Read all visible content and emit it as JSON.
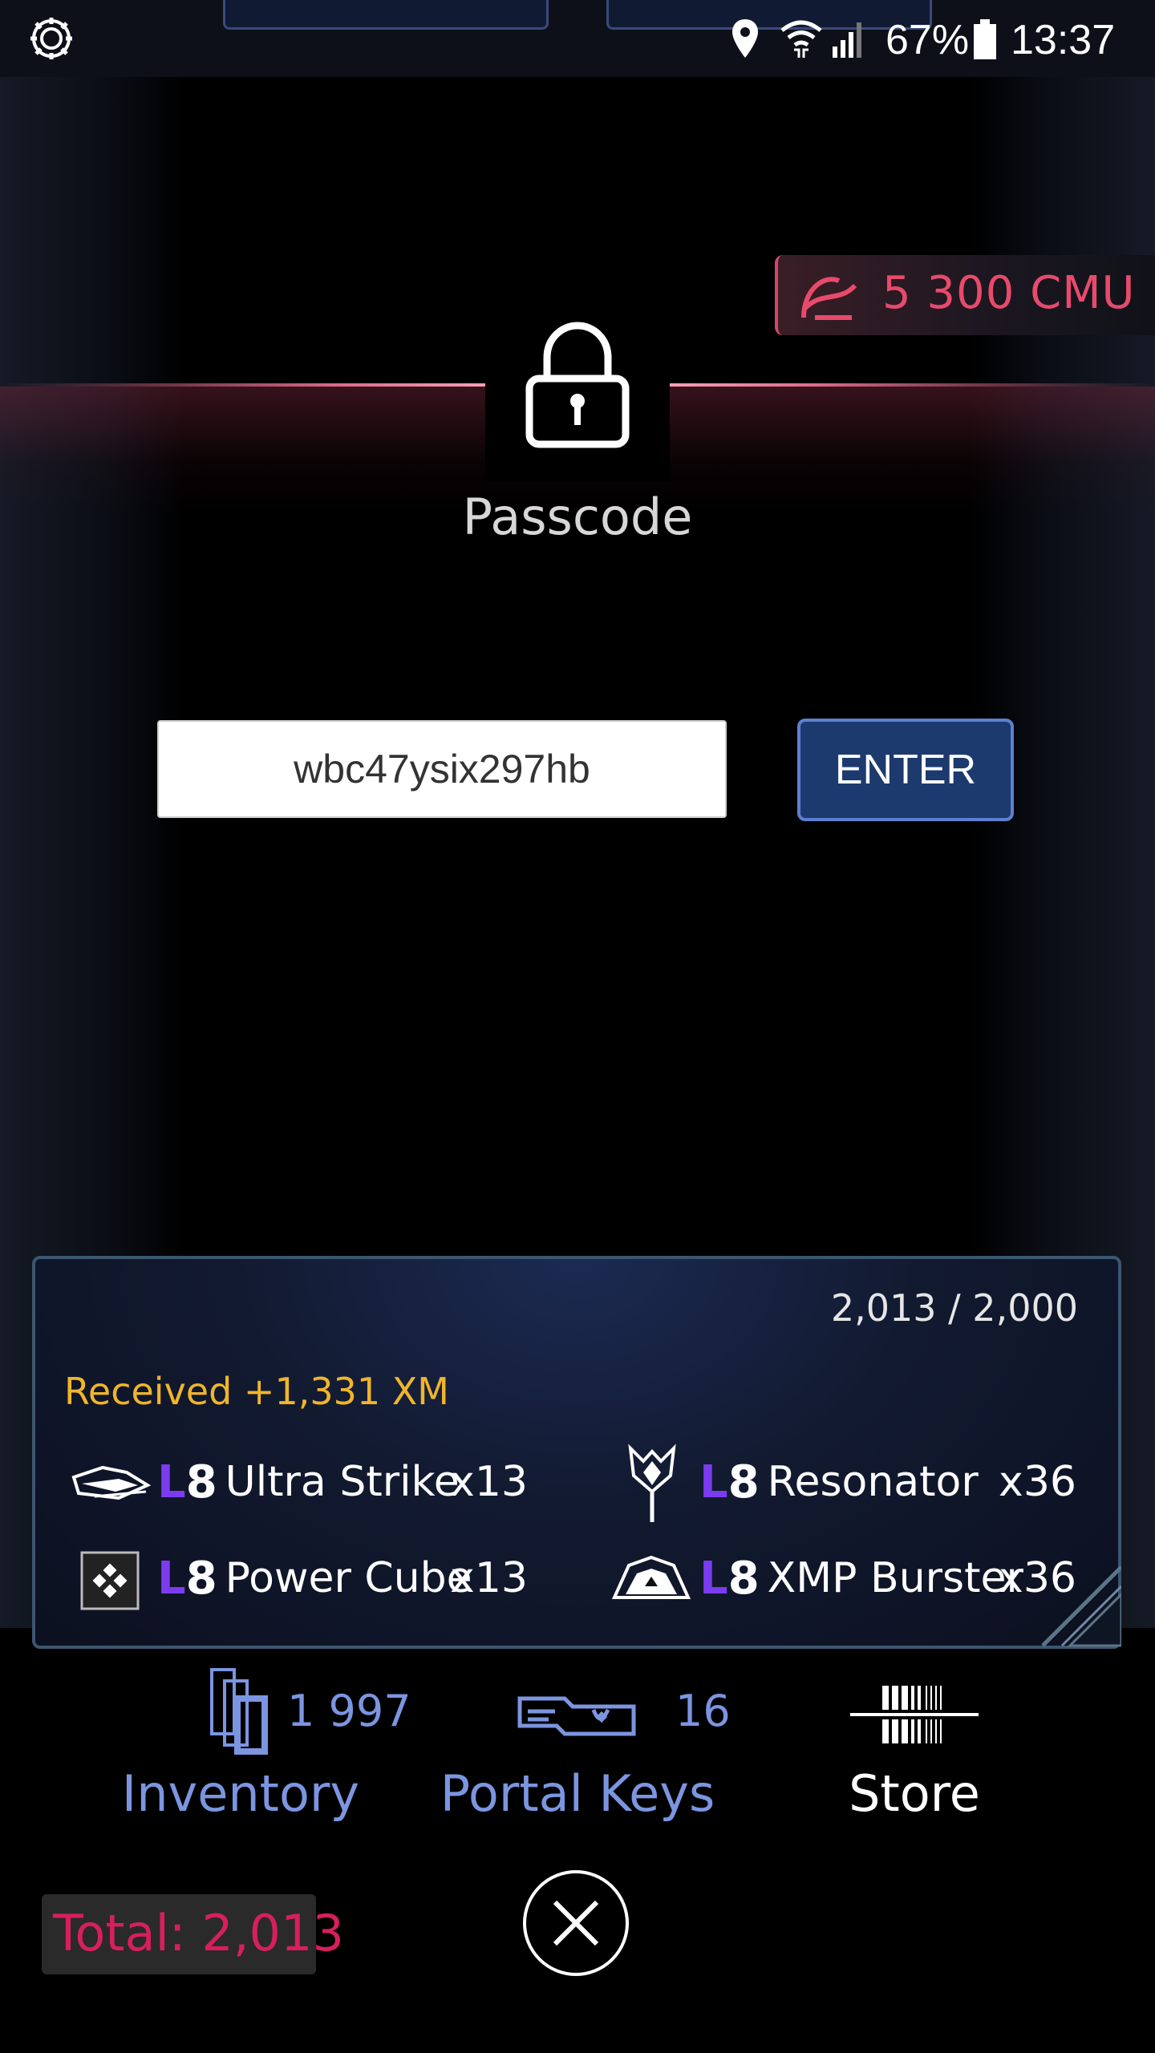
{
  "status_bar": {
    "battery": "67%",
    "time": "13:37"
  },
  "cmu": {
    "label": "5 300 CMU"
  },
  "passcode": {
    "title": "Passcode",
    "input_value": "wbc47ysix297hb",
    "enter_label": "ENTER"
  },
  "rewards": {
    "capacity": "2,013 / 2,000",
    "received": "Received +1,331 XM",
    "items": [
      {
        "level_l": "L",
        "level_n": "8",
        "name": "Ultra Strike",
        "count": "x13",
        "icon": "ultra-strike-icon"
      },
      {
        "level_l": "L",
        "level_n": "8",
        "name": "Resonator",
        "count": "x36",
        "icon": "resonator-icon"
      },
      {
        "level_l": "L",
        "level_n": "8",
        "name": "Power Cube",
        "count": "x13",
        "icon": "power-cube-icon"
      },
      {
        "level_l": "L",
        "level_n": "8",
        "name": "XMP Burster",
        "count": "x36",
        "icon": "xmp-burster-icon"
      }
    ]
  },
  "nav": {
    "inventory": {
      "count": "1 997",
      "label": "Inventory"
    },
    "portal_keys": {
      "count": "16",
      "label": "Portal Keys"
    },
    "store": {
      "label": "Store"
    }
  },
  "total": {
    "label": "Total: 2,013"
  },
  "colors": {
    "accent_blue": "#7b95e0",
    "cmu_pink": "#e84a6c",
    "xm_gold": "#f0b52a",
    "total_red": "#d61f5c",
    "level_purple": "#7b3cf0"
  }
}
